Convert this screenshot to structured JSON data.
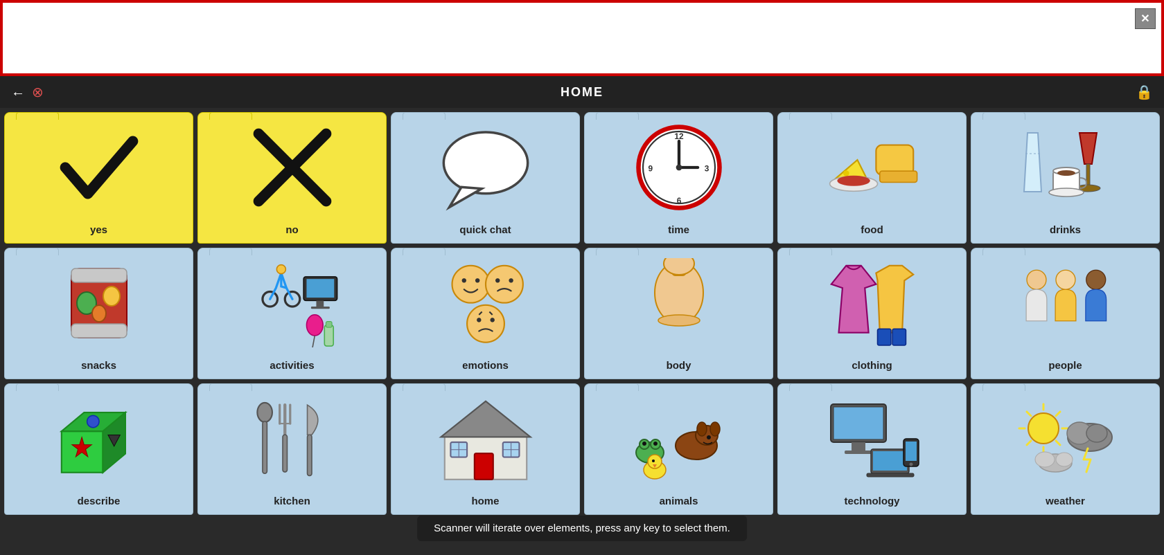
{
  "topBar": {
    "closeLabel": "✕"
  },
  "navBar": {
    "title": "HOME",
    "backIcon": "←",
    "cancelIcon": "⊗",
    "lockIcon": "🔒"
  },
  "grid": {
    "cells": [
      {
        "id": "yes",
        "label": "yes",
        "color": "yellow",
        "icon": "checkmark"
      },
      {
        "id": "no",
        "label": "no",
        "color": "yellow",
        "icon": "xmark"
      },
      {
        "id": "quick-chat",
        "label": "quick chat",
        "color": "blue",
        "icon": "speech-bubble"
      },
      {
        "id": "time",
        "label": "time",
        "color": "blue",
        "icon": "clock"
      },
      {
        "id": "food",
        "label": "food",
        "color": "blue",
        "icon": "food"
      },
      {
        "id": "drinks",
        "label": "drinks",
        "color": "blue",
        "icon": "drinks"
      },
      {
        "id": "snacks",
        "label": "snacks",
        "color": "blue",
        "icon": "snacks"
      },
      {
        "id": "activities",
        "label": "activities",
        "color": "blue",
        "icon": "activities"
      },
      {
        "id": "emotions",
        "label": "emotions",
        "color": "blue",
        "icon": "emotions"
      },
      {
        "id": "body",
        "label": "body",
        "color": "blue",
        "icon": "body"
      },
      {
        "id": "clothing",
        "label": "clothing",
        "color": "blue",
        "icon": "clothing"
      },
      {
        "id": "people",
        "label": "people",
        "color": "blue",
        "icon": "people"
      },
      {
        "id": "describe",
        "label": "describe",
        "color": "blue",
        "icon": "describe"
      },
      {
        "id": "kitchen",
        "label": "kitchen",
        "color": "blue",
        "icon": "kitchen"
      },
      {
        "id": "home",
        "label": "home",
        "color": "blue",
        "icon": "house"
      },
      {
        "id": "animals",
        "label": "animals",
        "color": "blue",
        "icon": "animals"
      },
      {
        "id": "technology",
        "label": "technology",
        "color": "blue",
        "icon": "technology"
      },
      {
        "id": "weather",
        "label": "weather",
        "color": "blue",
        "icon": "weather"
      }
    ]
  },
  "toast": {
    "text": "Scanner will iterate over elements, press any key to select them."
  }
}
